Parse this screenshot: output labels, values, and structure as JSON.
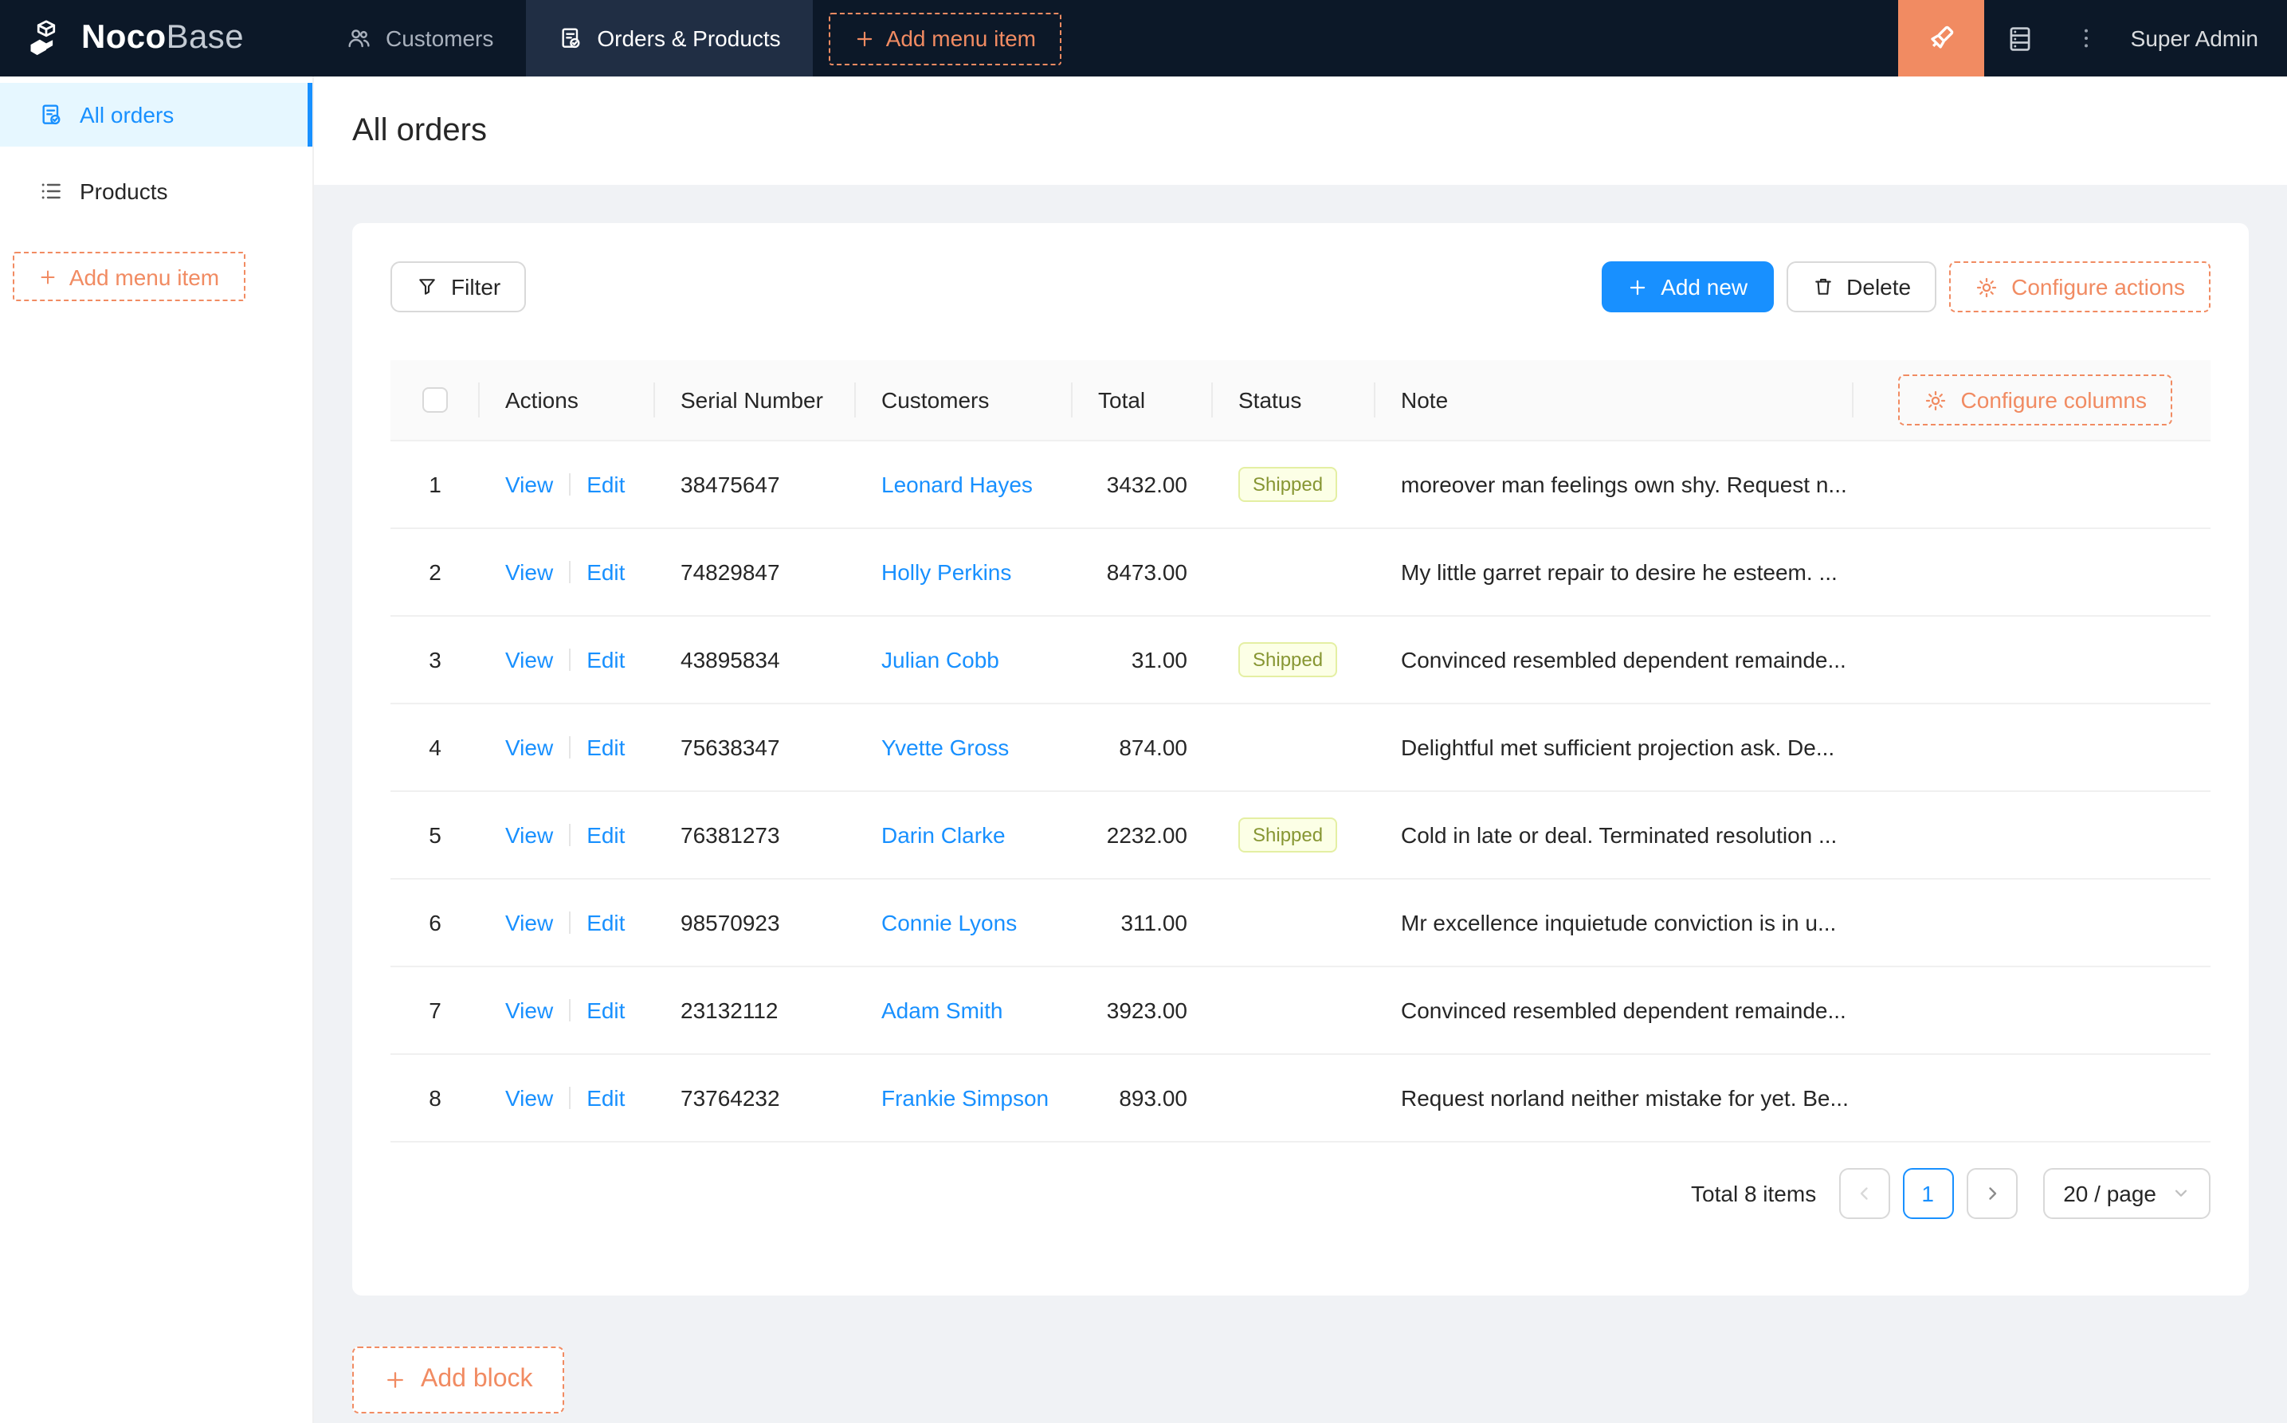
{
  "colors": {
    "primary_blue": "#1890ff",
    "designer_orange": "#f18b62",
    "navbar_bg": "#0c1828",
    "navbar_active_tab_bg": "#202e44",
    "page_bg": "#f0f2f5",
    "sidebar_active_bg": "#e6f7ff",
    "status_lime_bg": "#fcffe6",
    "status_lime_border": "#e4efa3",
    "status_lime_text": "#879633"
  },
  "navbar": {
    "logo_bold": "Noco",
    "logo_light": "Base",
    "tabs": [
      {
        "label": "Customers",
        "icon": "users-icon",
        "active": false
      },
      {
        "label": "Orders & Products",
        "icon": "orders-icon",
        "active": true
      }
    ],
    "add_menu_item_label": "Add menu item",
    "user": "Super Admin"
  },
  "sidebar": {
    "items": [
      {
        "label": "All orders",
        "icon": "orders-icon",
        "active": true
      },
      {
        "label": "Products",
        "icon": "list-icon",
        "active": false
      }
    ],
    "add_menu_item_label": "Add menu item"
  },
  "page": {
    "title": "All orders"
  },
  "toolbar": {
    "filter_label": "Filter",
    "add_new_label": "Add new",
    "delete_label": "Delete",
    "configure_actions_label": "Configure actions"
  },
  "table": {
    "columns": [
      "",
      "Actions",
      "Serial Number",
      "Customers",
      "Total",
      "Status",
      "Note"
    ],
    "configure_columns_label": "Configure columns",
    "action_labels": {
      "view": "View",
      "edit": "Edit"
    },
    "rows": [
      {
        "index": "1",
        "serial": "38475647",
        "customer": "Leonard Hayes",
        "total": "3432.00",
        "status": "Shipped",
        "note": "moreover man feelings own shy. Request n..."
      },
      {
        "index": "2",
        "serial": "74829847",
        "customer": "Holly Perkins",
        "total": "8473.00",
        "status": "",
        "note": "My little garret repair to desire he esteem. ..."
      },
      {
        "index": "3",
        "serial": "43895834",
        "customer": "Julian Cobb",
        "total": "31.00",
        "status": "Shipped",
        "note": "Convinced resembled dependent remainde..."
      },
      {
        "index": "4",
        "serial": "75638347",
        "customer": "Yvette Gross",
        "total": "874.00",
        "status": "",
        "note": "Delightful met sufficient projection ask. De..."
      },
      {
        "index": "5",
        "serial": "76381273",
        "customer": "Darin Clarke",
        "total": "2232.00",
        "status": "Shipped",
        "note": "Cold in late or deal. Terminated resolution ..."
      },
      {
        "index": "6",
        "serial": "98570923",
        "customer": "Connie Lyons",
        "total": "311.00",
        "status": "",
        "note": "Mr excellence inquietude conviction is in u..."
      },
      {
        "index": "7",
        "serial": "23132112",
        "customer": "Adam Smith",
        "total": "3923.00",
        "status": "",
        "note": "Convinced resembled dependent remainde..."
      },
      {
        "index": "8",
        "serial": "73764232",
        "customer": "Frankie Simpson",
        "total": "893.00",
        "status": "",
        "note": "Request norland neither mistake for yet. Be..."
      }
    ],
    "pagination": {
      "total_text": "Total 8 items",
      "current_page": "1",
      "page_size": "20 / page"
    }
  },
  "add_block_label": "Add block"
}
